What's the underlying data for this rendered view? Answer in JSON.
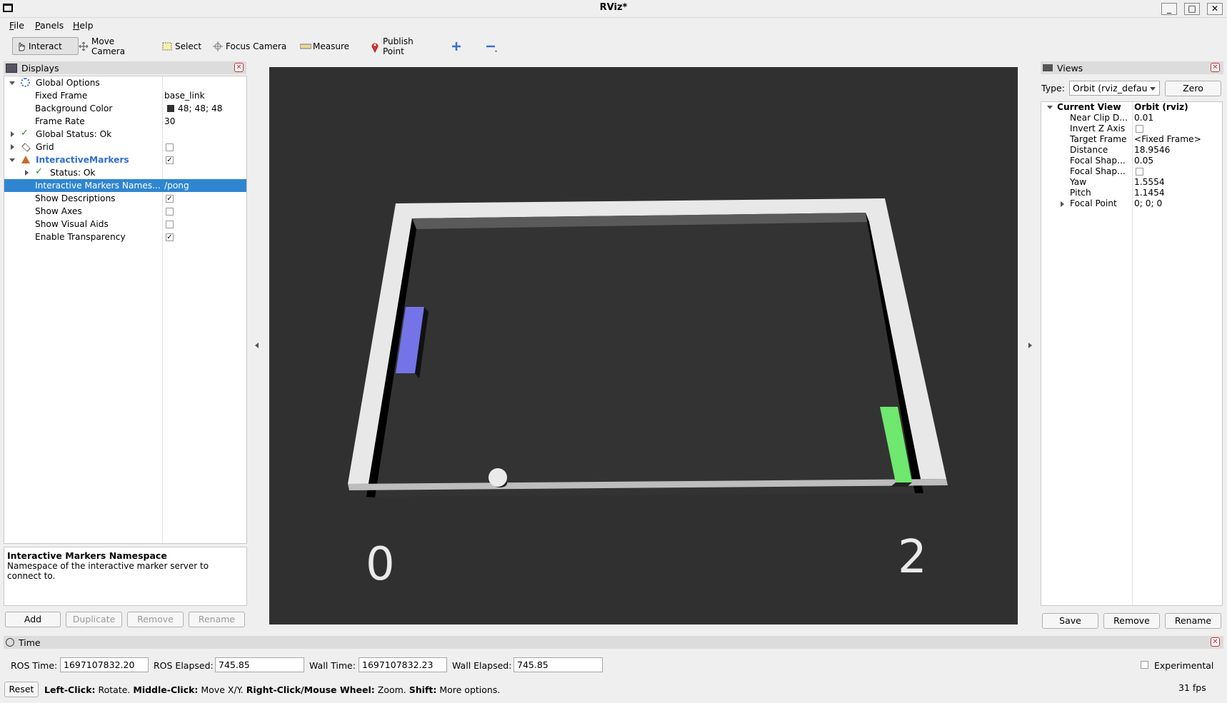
{
  "window": {
    "title": "RViz*"
  },
  "menu": [
    "File",
    "Panels",
    "Help"
  ],
  "toolbar": {
    "tools": [
      "Interact",
      "Move Camera",
      "Select",
      "Focus Camera",
      "Measure",
      "Publish Point"
    ],
    "active": "Interact"
  },
  "displays": {
    "title": "Displays",
    "global_options": "Global Options",
    "fixed_frame_label": "Fixed Frame",
    "fixed_frame_value": "base_link",
    "bg_color_label": "Background Color",
    "bg_color_value": "48; 48; 48",
    "bg_color_swatch": "#303030",
    "frame_rate_label": "Frame Rate",
    "frame_rate_value": "30",
    "global_status": "Global Status: Ok",
    "grid": "Grid",
    "interactive_markers": "InteractiveMarkers",
    "status_ok": "Status: Ok",
    "namespace_label": "Interactive Markers Names...",
    "namespace_value": "/pong",
    "show_descriptions": "Show Descriptions",
    "show_axes": "Show Axes",
    "show_visual_aids": "Show Visual Aids",
    "enable_transparency": "Enable Transparency",
    "description_title": "Interactive Markers Namespace",
    "description_text": "Namespace of the interactive marker server to connect to.",
    "buttons": {
      "add": "Add",
      "duplicate": "Duplicate",
      "remove": "Remove",
      "rename": "Rename"
    }
  },
  "scene": {
    "score_left": "0",
    "score_right": "2",
    "left_paddle_color": "#7474e8",
    "right_paddle_color": "#6ee86e"
  },
  "views": {
    "title": "Views",
    "type_label": "Type:",
    "type_value": "Orbit (rviz_defau",
    "zero_button": "Zero",
    "current_view_label": "Current View",
    "current_view_value": "Orbit (rviz)",
    "props": [
      {
        "label": "Near Clip D...",
        "value": "0.01"
      },
      {
        "label": "Invert Z Axis",
        "value": ""
      },
      {
        "label": "Target Frame",
        "value": "<Fixed Frame>"
      },
      {
        "label": "Distance",
        "value": "18.9546"
      },
      {
        "label": "Focal Shap...",
        "value": "0.05"
      },
      {
        "label": "Focal Shap...",
        "value": ""
      },
      {
        "label": "Yaw",
        "value": "1.5554"
      },
      {
        "label": "Pitch",
        "value": "1.1454"
      },
      {
        "label": "Focal Point",
        "value": "0; 0; 0"
      }
    ],
    "buttons": {
      "save": "Save",
      "remove": "Remove",
      "rename": "Rename"
    }
  },
  "time": {
    "title": "Time",
    "ros_time_label": "ROS Time:",
    "ros_time_value": "1697107832.20",
    "ros_elapsed_label": "ROS Elapsed:",
    "ros_elapsed_value": "745.85",
    "wall_time_label": "Wall Time:",
    "wall_time_value": "1697107832.23",
    "wall_elapsed_label": "Wall Elapsed:",
    "wall_elapsed_value": "745.85",
    "experimental": "Experimental"
  },
  "status": {
    "reset": "Reset",
    "hint_b1": "Left-Click:",
    "hint_t1": " Rotate. ",
    "hint_b2": "Middle-Click:",
    "hint_t2": " Move X/Y. ",
    "hint_b3": "Right-Click/Mouse Wheel:",
    "hint_t3": " Zoom. ",
    "hint_b4": "Shift:",
    "hint_t4": " More options.",
    "fps": "31 fps"
  }
}
